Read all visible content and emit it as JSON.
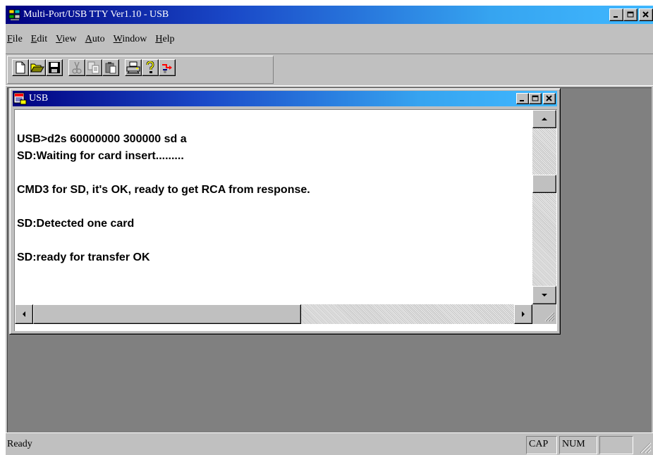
{
  "app": {
    "title": "Multi-Port/USB TTY Ver1.10 - USB",
    "caption_buttons": {
      "minimize": "_",
      "maximize": "□",
      "close": "✕"
    }
  },
  "menu": [
    {
      "label": "File",
      "key": "F",
      "rest": "ile"
    },
    {
      "label": "Edit",
      "key": "E",
      "rest": "dit"
    },
    {
      "label": "View",
      "key": "V",
      "rest": "iew"
    },
    {
      "label": "Auto",
      "key": "A",
      "rest": "uto"
    },
    {
      "label": "Window",
      "key": "W",
      "rest": "indow"
    },
    {
      "label": "Help",
      "key": "H",
      "rest": "elp"
    }
  ],
  "toolbar": {
    "buttons": [
      "new-icon",
      "open-icon",
      "save-icon",
      "cut-icon",
      "copy-icon",
      "paste-icon",
      "print-icon",
      "help-icon",
      "connect-icon"
    ]
  },
  "child": {
    "title": "USB",
    "lines": [
      "USB>d2s 60000000 300000 sd a",
      "SD:Waiting for card insert.........",
      "",
      "CMD3 for SD, it's OK, ready to get RCA from response.",
      "",
      "SD:Detected one card",
      "",
      "SD:ready for transfer OK"
    ]
  },
  "status": {
    "text": "Ready",
    "cap": "CAP",
    "num": "NUM",
    "scrl": ""
  },
  "colors": {
    "title_active_start": "#000080",
    "title_active_end": "#40b8ff",
    "face": "#c0c0c0",
    "mdi_background": "#808080"
  }
}
